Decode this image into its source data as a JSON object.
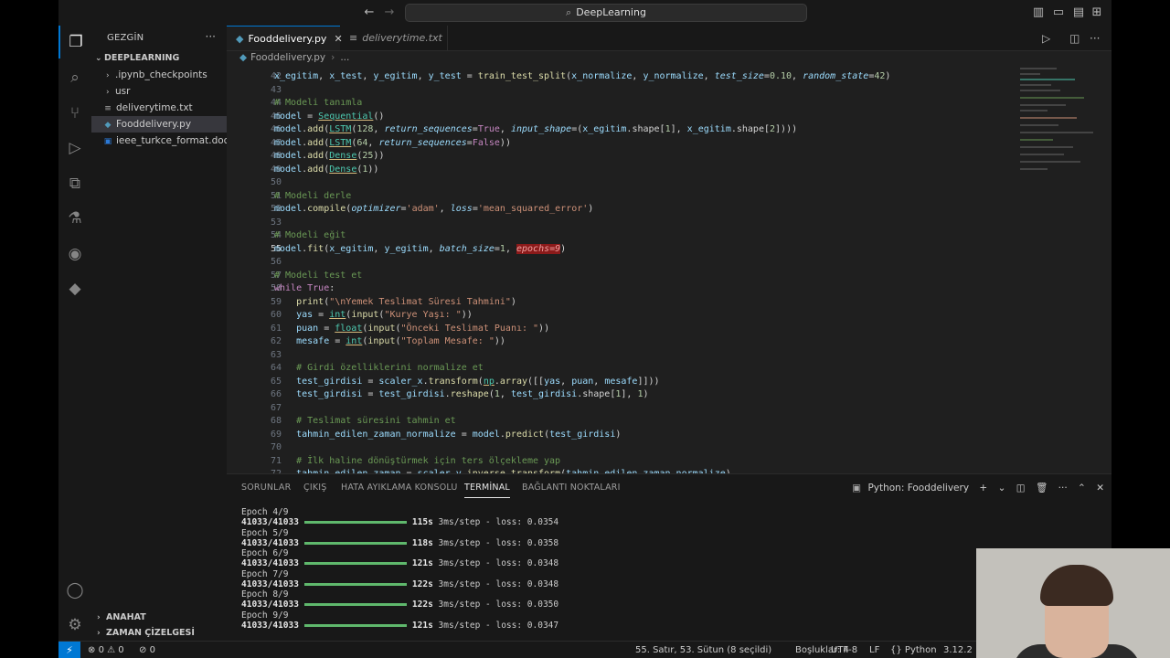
{
  "titlebar": {
    "search": "DeepLearning"
  },
  "sidebar": {
    "title": "GEZGİN",
    "project": "DEEPLEARNING",
    "items": [
      {
        "label": ".ipynb_checkpoints",
        "kind": "folder"
      },
      {
        "label": "usr",
        "kind": "folder"
      },
      {
        "label": "deliverytime.txt",
        "kind": "txt"
      },
      {
        "label": "Fooddelivery.py",
        "kind": "py"
      },
      {
        "label": "ieee_turkce_format.doc",
        "kind": "doc"
      }
    ],
    "outline": "ANAHAT",
    "timeline": "ZAMAN ÇİZELGESİ"
  },
  "tabs": [
    {
      "label": "Fooddelivery.py"
    },
    {
      "label": "deliverytime.txt"
    }
  ],
  "breadcrumb": {
    "file": "Fooddelivery.py",
    "rest": "..."
  },
  "code": {
    "line_numbers": [
      "42",
      "43",
      "44",
      "45",
      "46",
      "47",
      "48",
      "49",
      "50",
      "51",
      "52",
      "53",
      "54",
      "55",
      "56",
      "57",
      "58",
      "59",
      "60",
      "61",
      "62",
      "63",
      "64",
      "65",
      "66",
      "67",
      "68",
      "69",
      "70",
      "71",
      "72"
    ],
    "current_line": "55"
  },
  "panel": {
    "tabs": [
      "SORUNLAR",
      "ÇIKIŞ",
      "HATA AYIKLAMA KONSOLU",
      "TERMİNAL",
      "BAĞLANTI NOKTALARI"
    ],
    "active_tab": "TERMİNAL",
    "terminal_name": "Python: Fooddelivery",
    "progress": "41033/41033",
    "epochs": [
      {
        "label": "Epoch 4/9",
        "time": "115s",
        "rate": "3ms/step",
        "loss": "- loss: 0.0354"
      },
      {
        "label": "Epoch 5/9",
        "time": "118s",
        "rate": "3ms/step",
        "loss": "- loss: 0.0358"
      },
      {
        "label": "Epoch 6/9",
        "time": "121s",
        "rate": "3ms/step",
        "loss": "- loss: 0.0348"
      },
      {
        "label": "Epoch 7/9",
        "time": "122s",
        "rate": "3ms/step",
        "loss": "- loss: 0.0348"
      },
      {
        "label": "Epoch 8/9",
        "time": "122s",
        "rate": "3ms/step",
        "loss": "- loss: 0.0350"
      },
      {
        "label": "Epoch 9/9",
        "time": "121s",
        "rate": "3ms/step",
        "loss": "- loss: 0.0347"
      }
    ]
  },
  "statusbar": {
    "errors": "0",
    "warnings": "0",
    "ports": "0",
    "position": "55. Satır, 53. Sütun (8 seçildi)",
    "spaces": "Boşluklar: 4",
    "encoding": "UTF-8",
    "eol": "LF",
    "language": "Python",
    "version": "3.12.2"
  }
}
